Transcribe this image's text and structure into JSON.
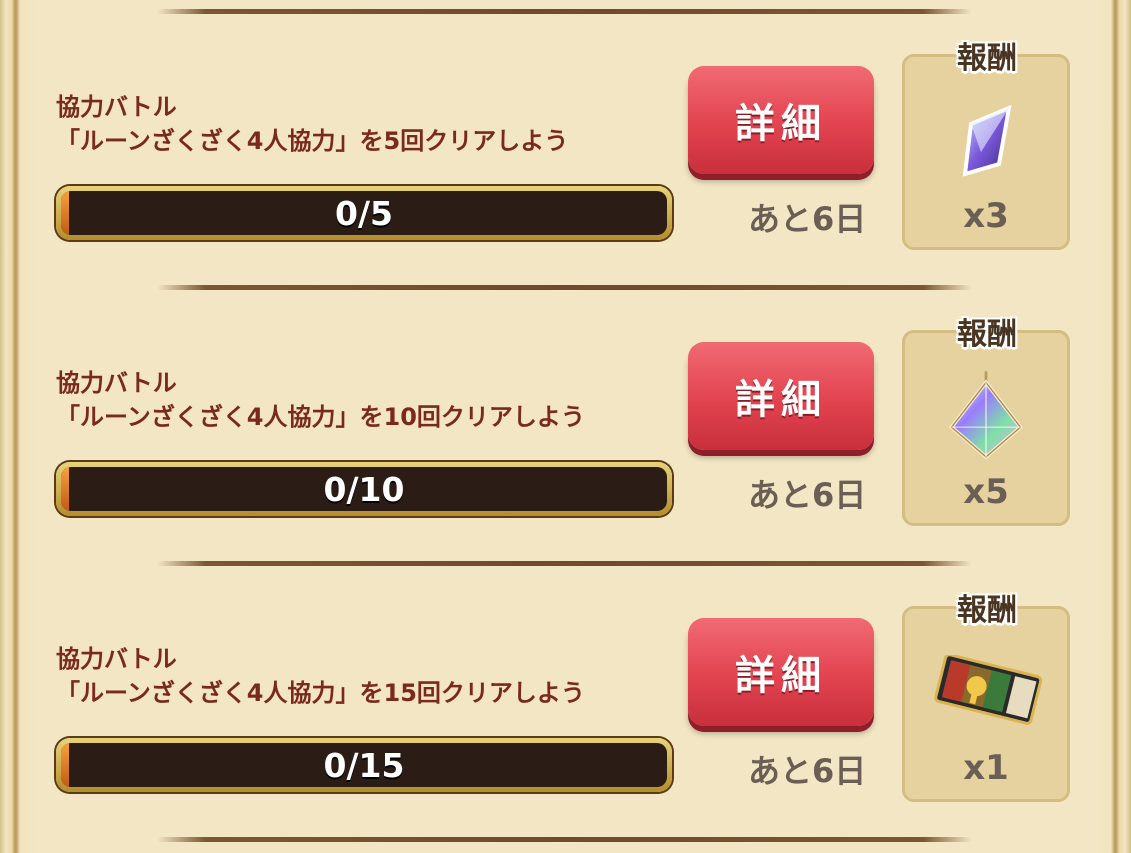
{
  "reward_label": "報酬",
  "missions": [
    {
      "category": "協力バトル",
      "title": "「ルーンざくざく4人協力」を5回クリアしよう",
      "progress_text": "0/5",
      "progress_value": 0,
      "progress_max": 5,
      "detail_label": "詳細",
      "remaining": "あと6日",
      "reward_icon": "crystal-shard-icon",
      "reward_count": "x3"
    },
    {
      "category": "協力バトル",
      "title": "「ルーンざくざく4人協力」を10回クリアしよう",
      "progress_text": "0/10",
      "progress_value": 0,
      "progress_max": 10,
      "detail_label": "詳細",
      "remaining": "あと6日",
      "reward_icon": "prism-gem-icon",
      "reward_count": "x5"
    },
    {
      "category": "協力バトル",
      "title": "「ルーンざくざく4人協力」を15回クリアしよう",
      "progress_text": "0/15",
      "progress_value": 0,
      "progress_max": 15,
      "detail_label": "詳細",
      "remaining": "あと6日",
      "reward_icon": "ticket-icon",
      "reward_count": "x1"
    }
  ]
}
